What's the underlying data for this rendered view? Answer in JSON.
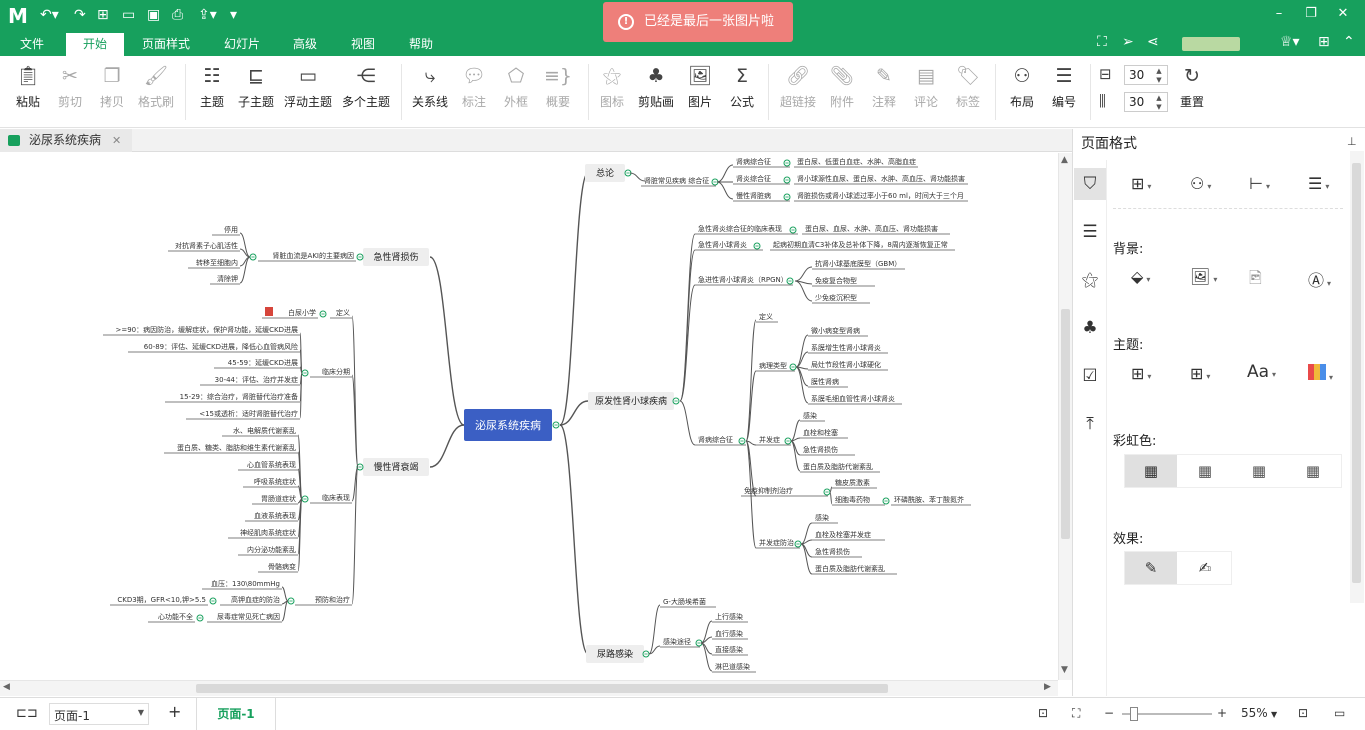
{
  "app": {
    "logo": "M"
  },
  "toast": {
    "text": "已经是最后一张图片啦",
    "icon": "alert-icon",
    "color": "#ee7f7a"
  },
  "menu": {
    "tabs": [
      "文件",
      "开始",
      "页面样式",
      "幻灯片",
      "高级",
      "视图",
      "帮助"
    ],
    "active": "开始"
  },
  "colors": {
    "brand": "#17a05d",
    "central": "#3b5fc4"
  },
  "toolbar": [
    {
      "label": "粘贴",
      "icon": "paste-icon"
    },
    {
      "label": "剪切",
      "icon": "cut-icon"
    },
    {
      "label": "拷贝",
      "icon": "copy-icon"
    },
    {
      "label": "格式刷",
      "icon": "format-brush-icon"
    },
    {
      "label": "主题",
      "icon": "topic-icon"
    },
    {
      "label": "子主题",
      "icon": "subtopic-icon"
    },
    {
      "label": "浮动主题",
      "icon": "floating-topic-icon"
    },
    {
      "label": "多个主题",
      "icon": "multiple-topics-icon"
    },
    {
      "label": "关系线",
      "icon": "relation-line-icon"
    },
    {
      "label": "标注",
      "icon": "callout-icon"
    },
    {
      "label": "外框",
      "icon": "boundary-icon"
    },
    {
      "label": "概要",
      "icon": "summary-icon"
    },
    {
      "label": "图标",
      "icon": "mark-icon"
    },
    {
      "label": "剪贴画",
      "icon": "clipart-icon"
    },
    {
      "label": "图片",
      "icon": "image-icon"
    },
    {
      "label": "公式",
      "icon": "formula-icon"
    },
    {
      "label": "超链接",
      "icon": "hyperlink-icon"
    },
    {
      "label": "附件",
      "icon": "attachment-icon"
    },
    {
      "label": "注释",
      "icon": "note-icon"
    },
    {
      "label": "评论",
      "icon": "comment-icon"
    },
    {
      "label": "标签",
      "icon": "tag-icon"
    },
    {
      "label": "布局",
      "icon": "layout-icon"
    },
    {
      "label": "编号",
      "icon": "numbering-icon"
    },
    {
      "label": "重置",
      "icon": "reset-icon"
    }
  ],
  "spacing": {
    "horizontal": "30",
    "vertical": "30"
  },
  "doc_tab": {
    "title": "泌尿系统疾病"
  },
  "panel": {
    "title": "页面格式",
    "background_label": "背景:",
    "theme_label": "主题:",
    "rainbow_label": "彩虹色:",
    "effect_label": "效果:"
  },
  "status": {
    "page_select": "页面-1",
    "active_page": "页面-1",
    "zoom": "55%"
  },
  "mindmap": {
    "central": "泌尿系统疾病",
    "branches": {
      "b1": "总论",
      "b1_1": "肾脏常见疾病 综合征",
      "b1_1_1": "肾病综合征",
      "b1_1_1a": "蛋白尿、低蛋白血症、水肿、高脂血症",
      "b1_1_2": "肾炎综合征",
      "b1_1_2a": "肾小球源性血尿、蛋白尿、水肿、高血压、肾功能损害",
      "b1_1_3": "慢性肾脏病",
      "b1_1_3a": "肾脏损伤或肾小球滤过率小于60 ml，时间大于三个月",
      "b2": "原发性肾小球疾病",
      "b2_1": "急性肾炎综合征的临床表现",
      "b2_1a": "蛋白尿、血尿、水肿、高血压、肾功能损害",
      "b2_2": "急性肾小球肾炎",
      "b2_2a": "起病初期血清C3补体及总补体下降，8周内逐渐恢复正常",
      "b2_3": "急进性肾小球肾炎（RPGN）",
      "b2_3a": "抗肾小球基底膜型（GBM）",
      "b2_3b": "免疫复合物型",
      "b2_3c": "少免疫沉积型",
      "b2_4": "肾病综合征",
      "b2_4a": "定义",
      "b2_4b": "病理类型",
      "b2_4b1": "微小病变型肾病",
      "b2_4b2": "系膜增生性肾小球肾炎",
      "b2_4b3": "局灶节段性肾小球硬化",
      "b2_4b4": "膜性肾病",
      "b2_4b5": "系膜毛细血管性肾小球肾炎",
      "b2_4c": "并发症",
      "b2_4c1": "感染",
      "b2_4c2": "血栓和栓塞",
      "b2_4c3": "急性肾损伤",
      "b2_4c4": "蛋白质及脂肪代谢紊乱",
      "b2_4d": "免疫抑制剂治疗",
      "b2_4d1": "糖皮质激素",
      "b2_4d2": "细胞毒药物",
      "b2_4d2a": "环磷酰胺、苯丁酸氮芥",
      "b2_4e": "并发症防治",
      "b2_4e1": "感染",
      "b2_4e2": "血栓及栓塞并发症",
      "b2_4e3": "急性肾损伤",
      "b2_4e4": "蛋白质及脂肪代谢紊乱",
      "b3": "尿路感染",
      "b3_1": "G-大肠埃希菌",
      "b3_2": "感染途径",
      "b3_2a": "上行感染",
      "b3_2b": "血行感染",
      "b3_2c": "直接感染",
      "b3_2d": "淋巴道感染",
      "l1": "急性肾损伤",
      "l1_1": "肾脏血流是AKI的主要病因",
      "l1_1a": "停用",
      "l1_1b": "对抗肾素子心肌活性",
      "l1_1c": "转移至细胞内",
      "l1_1d": "清除钾",
      "l2": "慢性肾衰竭",
      "l2_1": "定义",
      "l2_1a": "白尿小学",
      "l2_2": "临床分期",
      "l2_2a": ">=90：病因防治，缓解症状，保护肾功能，延缓CKD进展",
      "l2_2b": "60-89：评估、延缓CKD进展，降低心血管病风险",
      "l2_2c": "45-59：延缓CKD进展",
      "l2_2d": "30-44：评估、治疗并发症",
      "l2_2e": "15-29：综合治疗，肾脏替代治疗准备",
      "l2_2f": "<15或透析：适时肾脏替代治疗",
      "l2_3": "临床表现",
      "l2_3a": "水、电解质代谢紊乱",
      "l2_3b": "蛋白质、糖类、脂肪和维生素代谢紊乱",
      "l2_3c": "心血管系统表现",
      "l2_3d": "呼吸系统症状",
      "l2_3e": "胃肠道症状",
      "l2_3f": "血液系统表现",
      "l2_3g": "神经肌肉系统症状",
      "l2_3h": "内分泌功能紊乱",
      "l2_3i": "骨骼病变",
      "l2_4": "预防和治疗",
      "l2_4a": "血压：130\\80mmHg",
      "l2_4b": "高钾血症的防治",
      "l2_4b0": "CKD3期，GFR<10,钾>5.5",
      "l2_4c": "尿毒症常见死亡病因",
      "l2_4c0": "心功能不全"
    }
  }
}
